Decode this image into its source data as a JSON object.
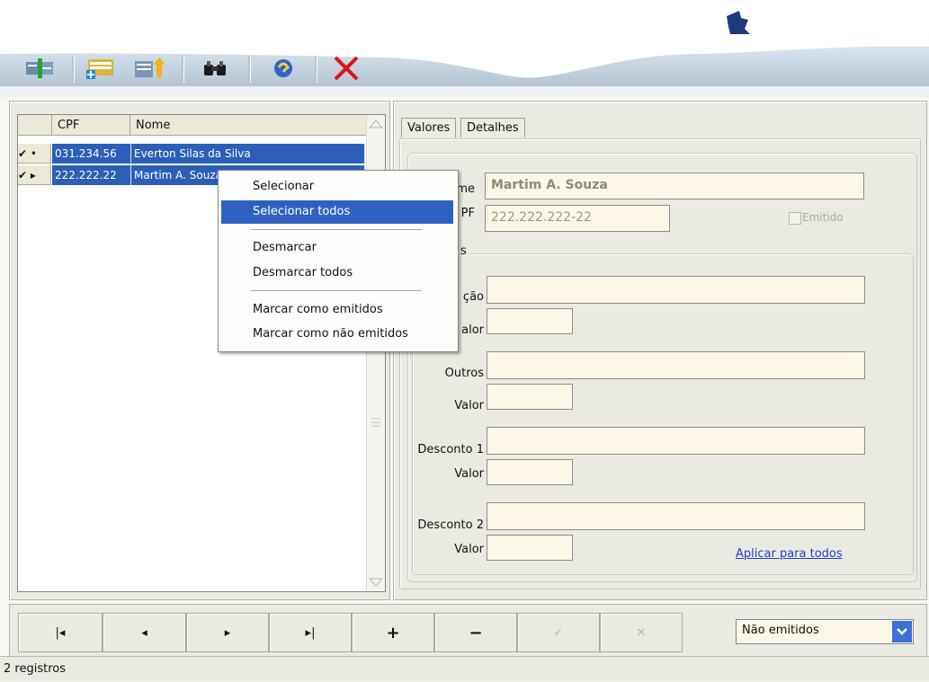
{
  "toolbar": {
    "buttons": [
      {
        "name": "grid-refresh-icon"
      },
      {
        "name": "grid-add-icon"
      },
      {
        "name": "grid-export-icon"
      },
      {
        "name": "binoculars-icon"
      },
      {
        "name": "help-icon"
      },
      {
        "name": "close-icon"
      }
    ]
  },
  "grid": {
    "columns": [
      "CPF",
      "Nome"
    ],
    "rows": [
      {
        "indicator": "✔ •",
        "cpf": "031.234.56",
        "nome": "Everton Silas da Silva"
      },
      {
        "indicator": "✔ ▸",
        "cpf": "222.222.22",
        "nome": "Martim A. Souza"
      }
    ]
  },
  "context_menu": {
    "items": [
      {
        "label": "Selecionar",
        "accesskey": "S",
        "selected": false
      },
      {
        "label": "Selecionar todos",
        "accesskey": "e",
        "selected": true
      },
      {
        "label": "Desmarcar",
        "accesskey": "D",
        "selected": false
      },
      {
        "label": "Desmarcar todos",
        "accesskey": "m",
        "selected": false
      },
      {
        "label": "Marcar como emitidos",
        "accesskey": "a",
        "selected": false
      },
      {
        "label": "Marcar como não emitidos",
        "accesskey": "r",
        "selected": false
      }
    ]
  },
  "tabs": [
    "Valores",
    "Detalhes"
  ],
  "form": {
    "nome_label": "me",
    "nome_value": "Martim A. Souza",
    "cpf_label": "PF",
    "cpf_value": "222.222.222-22",
    "emitido_label": "Emitido",
    "group_label": "s",
    "fields": [
      {
        "label": "ção"
      },
      {
        "label": "alor"
      },
      {
        "label": "Outros"
      },
      {
        "label": "Valor"
      },
      {
        "label": "Desconto 1"
      },
      {
        "label": "Valor"
      },
      {
        "label": "Desconto 2"
      },
      {
        "label": "Valor"
      }
    ],
    "apply_all": "Aplicar para todos"
  },
  "nav": {
    "buttons": [
      "|◂",
      "◂",
      "▸",
      "▸|",
      "+",
      "−",
      "✓",
      "✕"
    ],
    "filter_value": "Não emitidos"
  },
  "status": "2 registros",
  "colors": {
    "selection": "#2b5fb8",
    "menu_highlight": "#2f62c0",
    "close": "#e0121b"
  }
}
